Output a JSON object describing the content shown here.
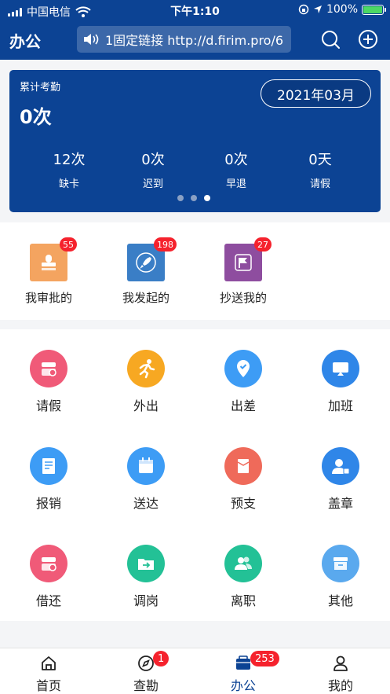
{
  "status_bar": {
    "carrier": "中国电信",
    "time": "下午1:10",
    "battery": "100%"
  },
  "header": {
    "title": "办公",
    "notice": "1固定链接 http://d.firim.pro/6"
  },
  "summary": {
    "label": "累计考勤",
    "value": "0次",
    "month": "2021年03月",
    "stats": [
      {
        "value": "12次",
        "label": "缺卡"
      },
      {
        "value": "0次",
        "label": "迟到"
      },
      {
        "value": "0次",
        "label": "早退"
      },
      {
        "value": "0天",
        "label": "请假"
      }
    ],
    "page_index": 3,
    "page_count": 3
  },
  "approvals": [
    {
      "label": "我审批的",
      "badge": "55",
      "icon": "stamp-icon",
      "color": "#f4a460"
    },
    {
      "label": "我发起的",
      "badge": "198",
      "icon": "rocket-icon",
      "color": "#3a7ec6"
    },
    {
      "label": "抄送我的",
      "badge": "27",
      "icon": "flag-icon",
      "color": "#8e4d9f"
    }
  ],
  "apps": [
    {
      "label": "请假",
      "icon": "leave-icon",
      "color": "#f05a78"
    },
    {
      "label": "外出",
      "icon": "runner-icon",
      "color": "#f7a822"
    },
    {
      "label": "出差",
      "icon": "location-pin-icon",
      "color": "#3d9cf5"
    },
    {
      "label": "加班",
      "icon": "screen-icon",
      "color": "#2f86e8"
    },
    {
      "label": "报销",
      "icon": "document-icon",
      "color": "#3d9cf5"
    },
    {
      "label": "送达",
      "icon": "calendar-icon",
      "color": "#3d9cf5"
    },
    {
      "label": "预支",
      "icon": "envelope-icon",
      "color": "#ef6a5a"
    },
    {
      "label": "盖章",
      "icon": "user-stamp-icon",
      "color": "#2f86e8"
    },
    {
      "label": "借还",
      "icon": "return-icon",
      "color": "#f05a78"
    },
    {
      "label": "调岗",
      "icon": "folder-transfer-icon",
      "color": "#23c196"
    },
    {
      "label": "离职",
      "icon": "people-icon",
      "color": "#23c196"
    },
    {
      "label": "其他",
      "icon": "box-icon",
      "color": "#5aa9ee"
    }
  ],
  "tabs": [
    {
      "label": "首页",
      "icon": "home-icon",
      "badge": ""
    },
    {
      "label": "查勘",
      "icon": "compass-icon",
      "badge": "1"
    },
    {
      "label": "办公",
      "icon": "briefcase-icon",
      "badge": "253",
      "active": true
    },
    {
      "label": "我的",
      "icon": "user-icon",
      "badge": ""
    }
  ],
  "colors": {
    "primary": "#0c4394",
    "badge": "#f5222d",
    "battery": "#4cd964"
  }
}
